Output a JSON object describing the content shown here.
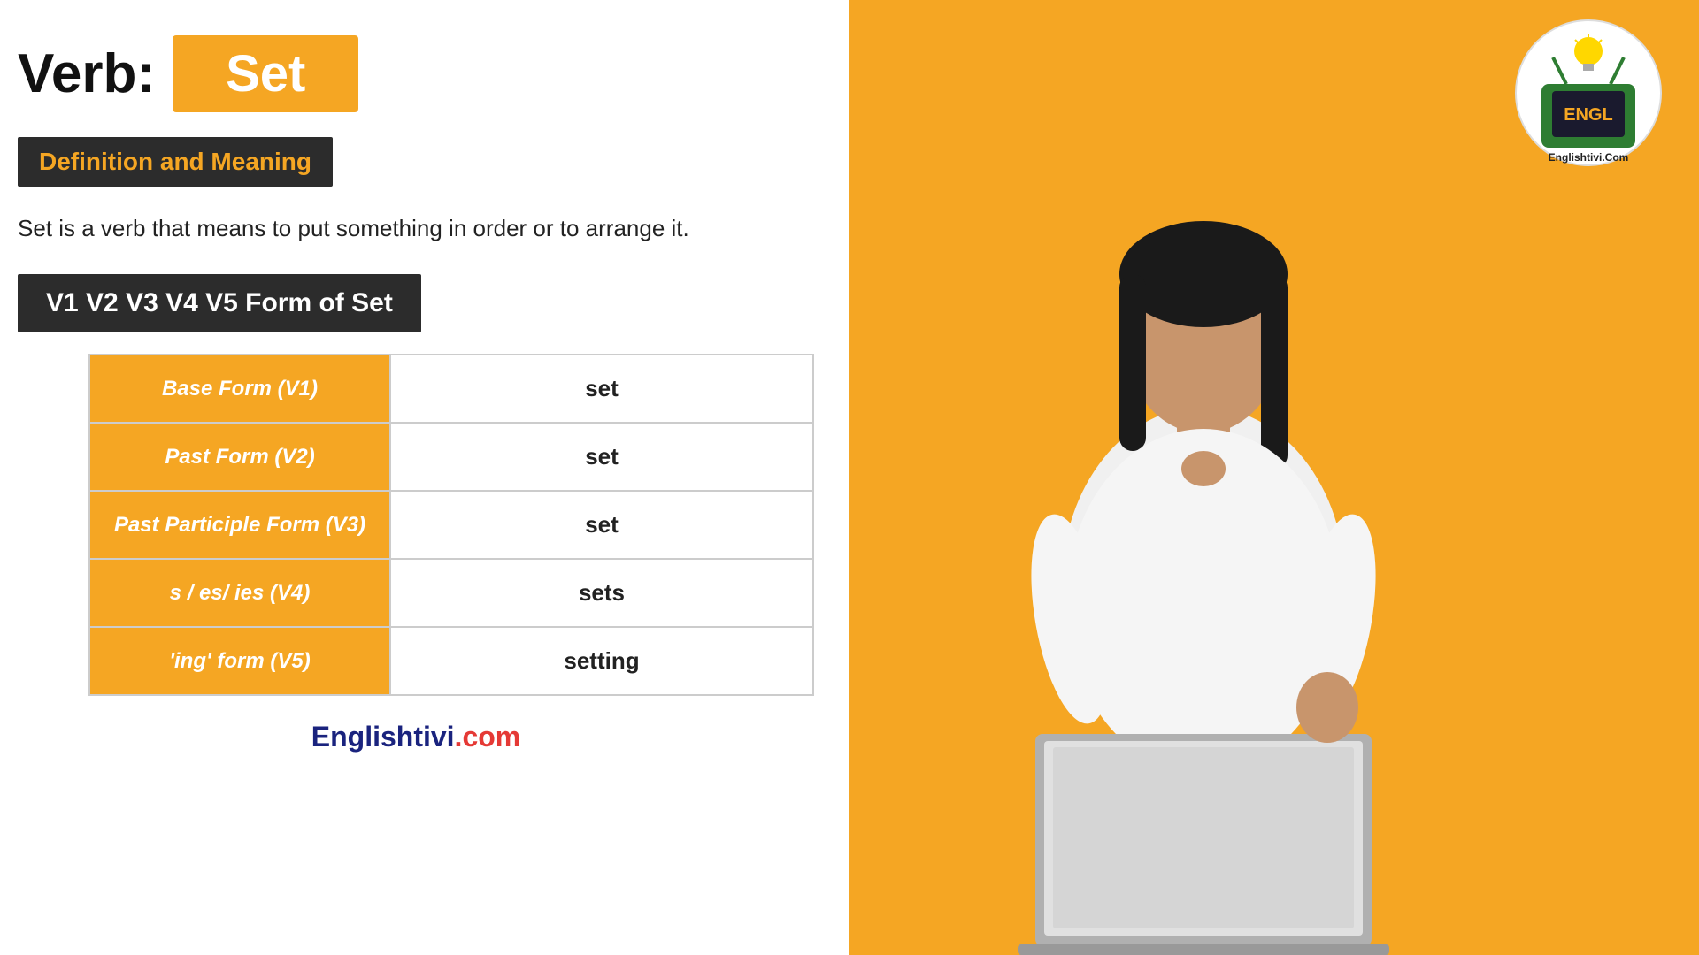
{
  "header": {
    "verb_label": "Verb:",
    "verb_word": "Set"
  },
  "definition_section": {
    "banner_text": "Definition and Meaning",
    "definition_text": "Set is a verb that means to put something in order or to arrange it."
  },
  "forms_section": {
    "banner_text": "V1 V2 V3 V4 V5 Form of Set",
    "table_rows": [
      {
        "label": "Base Form (V1)",
        "value": "set"
      },
      {
        "label": "Past Form (V2)",
        "value": "set"
      },
      {
        "label": "Past Participle Form (V3)",
        "value": "set"
      },
      {
        "label": "s / es/ ies (V4)",
        "value": "sets"
      },
      {
        "label": "'ing' form (V5)",
        "value": "setting"
      }
    ]
  },
  "footer": {
    "brand_blue": "Englishtivi",
    "brand_red": ".com"
  },
  "logo": {
    "site_name": "Englishtivi.Com"
  },
  "colors": {
    "orange": "#F5A623",
    "dark": "#2c2c2c",
    "white": "#ffffff"
  }
}
